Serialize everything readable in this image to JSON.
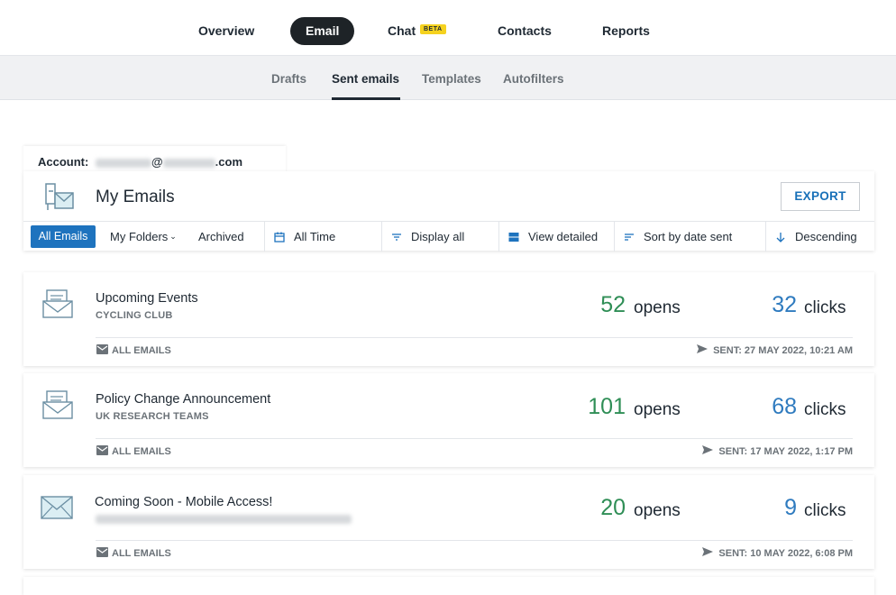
{
  "top_nav": {
    "items": [
      {
        "label": "Overview"
      },
      {
        "label": "Email"
      },
      {
        "label": "Chat",
        "badge": "BETA"
      },
      {
        "label": "Contacts"
      },
      {
        "label": "Reports"
      }
    ],
    "active": "Email"
  },
  "sub_nav": {
    "items": [
      {
        "label": "Drafts"
      },
      {
        "label": "Sent emails"
      },
      {
        "label": "Templates"
      },
      {
        "label": "Autofilters"
      }
    ],
    "active": "Sent emails"
  },
  "account": {
    "label": "Account:",
    "email_at": "@",
    "email_domain": ".com"
  },
  "panel": {
    "title": "My Emails",
    "export_label": "EXPORT",
    "filters": {
      "all_emails": "All Emails",
      "my_folders": "My Folders",
      "archived": "Archived",
      "time": "All Time",
      "display": "Display all",
      "view": "View detailed",
      "sort": "Sort by date sent",
      "order": "Descending"
    }
  },
  "emails": [
    {
      "subject": "Upcoming Events",
      "audience": "CYCLING CLUB",
      "opens": "52",
      "opens_label": "opens",
      "clicks": "32",
      "clicks_label": "clicks",
      "folder": "ALL EMAILS",
      "sent": "SENT: 27 MAY 2022, 10:21 AM"
    },
    {
      "subject": "Policy Change Announcement",
      "audience": "UK RESEARCH TEAMS",
      "opens": "101",
      "opens_label": "opens",
      "clicks": "68",
      "clicks_label": "clicks",
      "folder": "ALL EMAILS",
      "sent": "SENT: 17 MAY 2022, 1:17 PM"
    },
    {
      "subject": "Coming Soon - Mobile Access!",
      "audience": "",
      "opens": "20",
      "opens_label": "opens",
      "clicks": "9",
      "clicks_label": "clicks",
      "folder": "ALL EMAILS",
      "sent": "SENT: 10 MAY 2022, 6:08 PM"
    }
  ],
  "colors": {
    "accent_blue": "#1e73be",
    "opens_green": "#2f8e56",
    "clicks_blue": "#2f7bbf",
    "beta_yellow": "#f5d21f",
    "active_pill": "#1e2327"
  },
  "icons": [
    "mailbox-icon",
    "envelope-icon",
    "calendar-icon",
    "filter-icon",
    "view-icon",
    "sort-icon",
    "arrow-down-icon",
    "mail-icon",
    "send-icon",
    "chevron-down-icon"
  ]
}
